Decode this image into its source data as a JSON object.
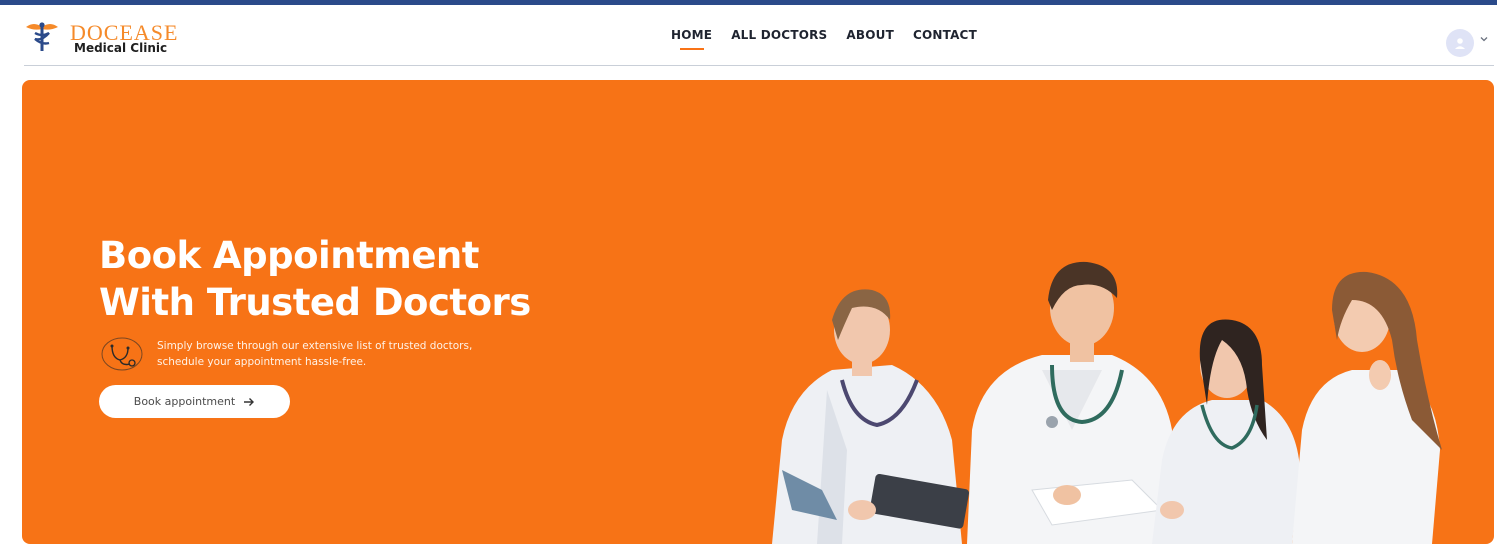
{
  "brand": {
    "title": "DOCEASE",
    "subtitle": "Medical Clinic",
    "icon": "caduceus-icon"
  },
  "nav": {
    "items": [
      {
        "label": "HOME",
        "active": true
      },
      {
        "label": "ALL DOCTORS",
        "active": false
      },
      {
        "label": "ABOUT",
        "active": false
      },
      {
        "label": "CONTACT",
        "active": false
      }
    ]
  },
  "profile": {
    "avatar_icon": "user-icon",
    "menu_icon": "chevron-down-icon"
  },
  "hero": {
    "title_line1": "Book Appointment",
    "title_line2": "With Trusted Doctors",
    "description_line1": "Simply browse through our extensive list of trusted doctors,",
    "description_line2": "schedule your appointment hassle-free.",
    "description_icon": "stethoscope-icon",
    "cta_label": "Book appointment",
    "cta_icon": "arrow-right-icon",
    "image": "doctors-group-image"
  },
  "colors": {
    "accent": "#f77316",
    "brand_title": "#f58a2a",
    "topline": "#2b4a8a"
  }
}
